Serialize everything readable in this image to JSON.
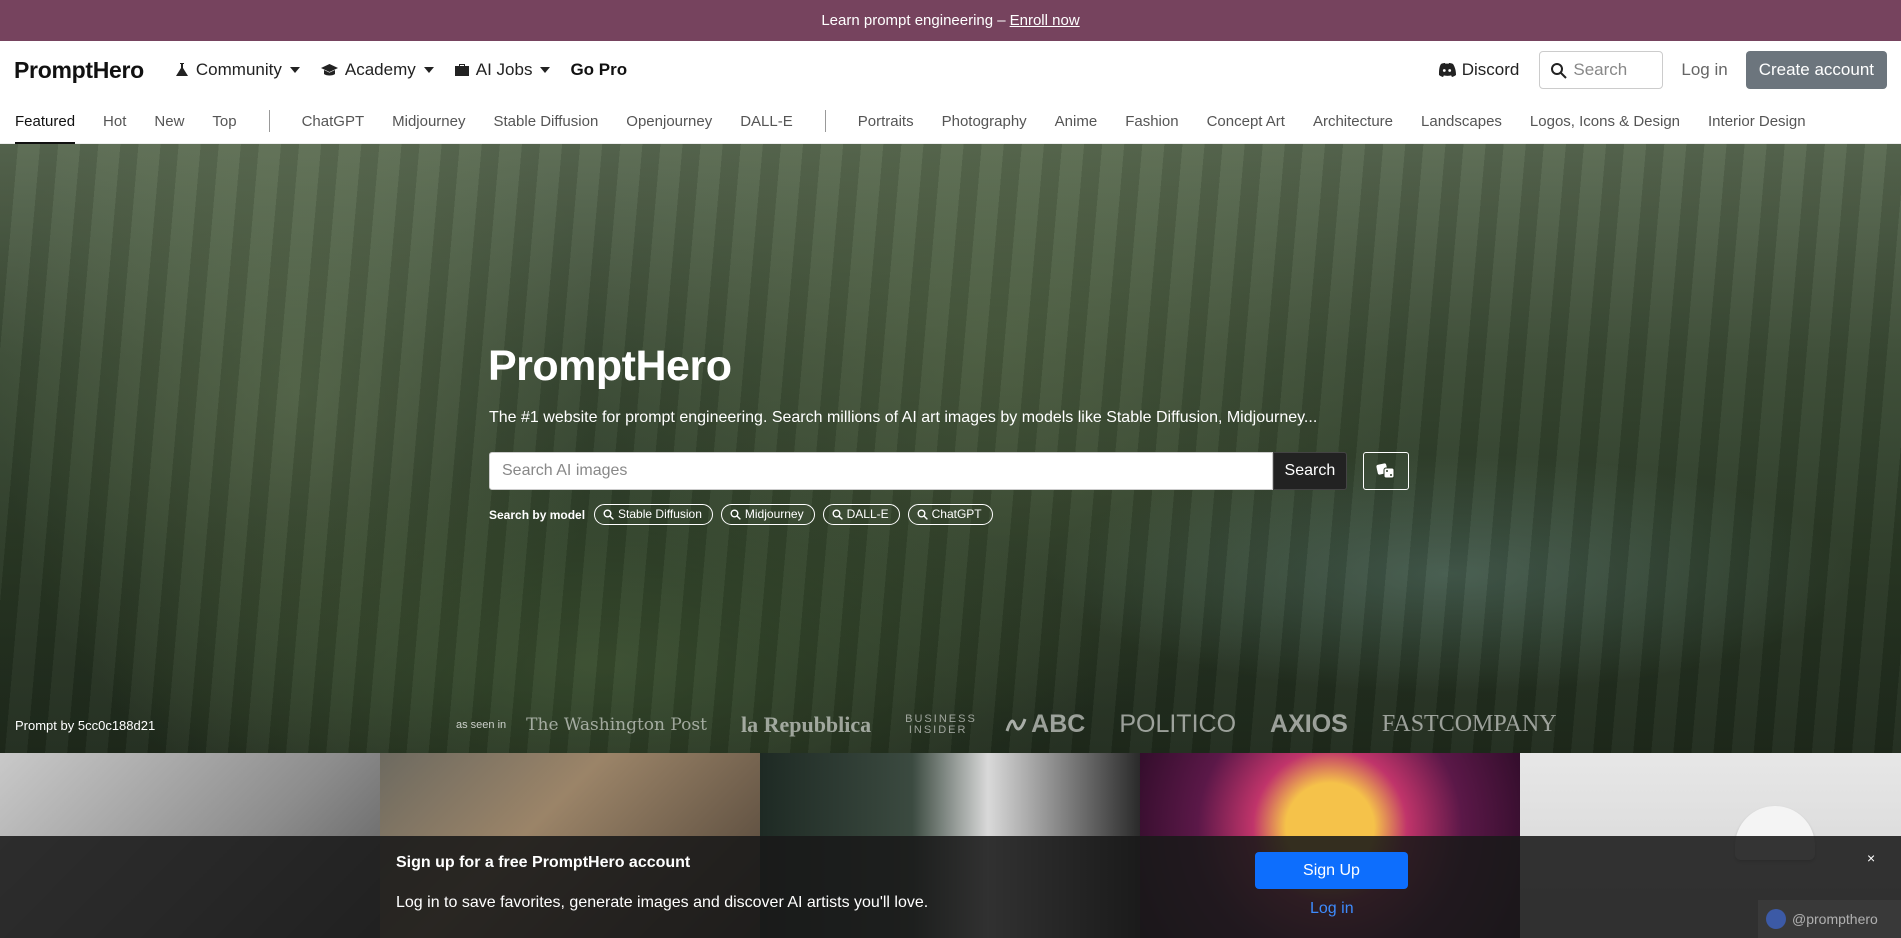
{
  "banner": {
    "text": "Learn prompt engineering –",
    "link": "Enroll now"
  },
  "navbar": {
    "brand": "PromptHero",
    "links": [
      {
        "label": "Community",
        "icon": "flask-icon",
        "dropdown": true
      },
      {
        "label": "Academy",
        "icon": "graduation-cap-icon",
        "dropdown": true
      },
      {
        "label": "AI Jobs",
        "icon": "briefcase-icon",
        "dropdown": true
      },
      {
        "label": "Go Pro",
        "dropdown": false
      }
    ],
    "discord": "Discord",
    "search_placeholder": "Search",
    "login": "Log in",
    "create_account": "Create account"
  },
  "subnav": {
    "group1": [
      "Featured",
      "Hot",
      "New",
      "Top"
    ],
    "group2": [
      "ChatGPT",
      "Midjourney",
      "Stable Diffusion",
      "Openjourney",
      "DALL-E"
    ],
    "group3": [
      "Portraits",
      "Photography",
      "Anime",
      "Fashion",
      "Concept Art",
      "Architecture",
      "Landscapes",
      "Logos, Icons & Design",
      "Interior Design"
    ],
    "active": "Featured"
  },
  "hero": {
    "title": "PromptHero",
    "subtitle": "The #1 website for prompt engineering. Search millions of AI art images by models like Stable Diffusion, Midjourney...",
    "search_placeholder": "Search AI images",
    "search_button": "Search",
    "models_label": "Search by model",
    "models": [
      "Stable Diffusion",
      "Midjourney",
      "DALL-E",
      "ChatGPT"
    ],
    "prompt_by": "Prompt by 5cc0c188d21"
  },
  "as_seen_in": {
    "label": "as seen in",
    "logos": [
      "The Washington Post",
      "la Repubblica",
      "BUSINESS INSIDER",
      "ABC",
      "POLITICO",
      "AXIOS",
      "FASTCOMPANY"
    ]
  },
  "signup": {
    "title": "Sign up for a free PromptHero account",
    "text": "Log in to save favorites, generate images and discover AI artists you'll love.",
    "button": "Sign Up",
    "login": "Log in",
    "close": "×"
  },
  "watermark": "@prompthero",
  "colors": {
    "banner": "#76435e",
    "primary": "#0d6efd",
    "create_btn": "#6c757d"
  }
}
